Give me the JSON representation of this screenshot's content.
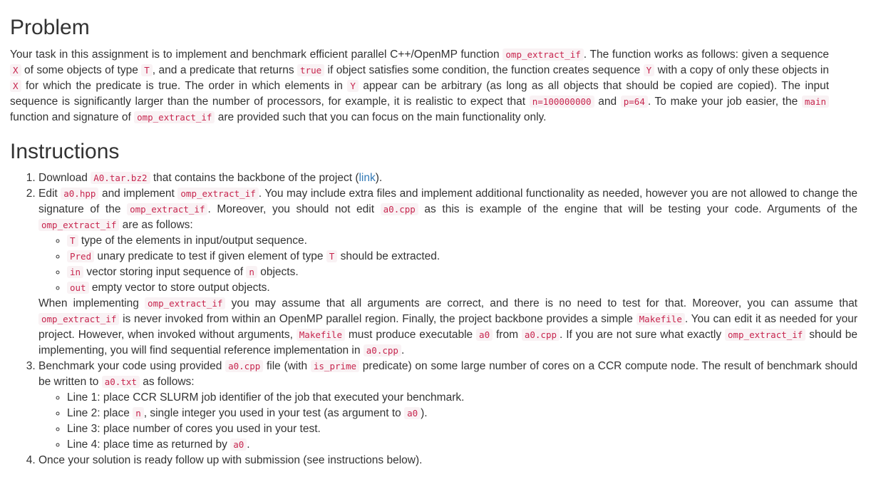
{
  "headings": {
    "problem": "Problem",
    "instructions": "Instructions"
  },
  "problem": {
    "t1": "Your task in this assignment is to implement and benchmark efficient parallel C++/OpenMP function ",
    "c1": "omp_extract_if",
    "t2": ". The function works as follows: given a sequence ",
    "c2": "X",
    "t3": " of some objects of type ",
    "c3": "T",
    "t4": ", and a predicate that returns ",
    "c4": "true",
    "t5": " if object satisfies some condition, the function creates sequence ",
    "c5": "Y",
    "t6": " with a copy of only these objects in ",
    "c6": "X",
    "t7": " for which the predicate is true. The order in which elements in ",
    "c7": "Y",
    "t8": " appear can be arbitrary (as long as all objects that should be copied are copied). The input sequence is significantly larger than the number of processors, for example, it is realistic to expect that ",
    "c8": "n=100000000",
    "t9": " and ",
    "c9": "p=64",
    "t10": ". To make your job easier, the ",
    "c10": "main",
    "t11": " function and signature of ",
    "c11": "omp_extract_if",
    "t12": " are provided such that you can focus on the main functionality only."
  },
  "steps": {
    "s1": {
      "t1": "Download ",
      "c1": "A0.tar.bz2",
      "t2": " that contains the backbone of the project (",
      "link": "link",
      "t3": ")."
    },
    "s2": {
      "t1": "Edit ",
      "c1": "a0.hpp",
      "t2": " and implement ",
      "c2": "omp_extract_if",
      "t3": ". You may include extra files and implement additional functionality as needed, however you are not allowed to change the signature of the ",
      "c3": "omp_extract_if",
      "t4": ". Moreover, you should not edit ",
      "c4": "a0.cpp",
      "t5": " as this is example of the engine that will be testing your code. Arguments of the ",
      "c5": "omp_extract_if",
      "t6": " are as follows:",
      "args": [
        {
          "code": "T",
          "text": " type of the elements in input/output sequence."
        },
        {
          "code": "Pred",
          "text": " unary predicate to test if given element of type ",
          "code2": "T",
          "text2": " should be extracted."
        },
        {
          "code": "in",
          "text": " vector storing input sequence of ",
          "code2": "n",
          "text2": " objects."
        },
        {
          "code": "out",
          "text": " empty vector to store output objects."
        }
      ],
      "w1": "When implementing ",
      "wc1": "omp_extract_if",
      "w2": " you may assume that all arguments are correct, and there is no need to test for that. Moreover, you can assume that ",
      "wc2": "omp_extract_if",
      "w3": " is never invoked from within an OpenMP parallel region. Finally, the project backbone provides a simple ",
      "wc3": "Makefile",
      "w4": ". You can edit it as needed for your project. However, when invoked without arguments, ",
      "wc4": "Makefile",
      "w5": " must produce executable ",
      "wc5": "a0",
      "w6": " from ",
      "wc6": "a0.cpp",
      "w7": ". If you are not sure what exactly ",
      "wc7": "omp_extract_if",
      "w8": " should be implementing, you will find sequential reference implementation in ",
      "wc8": "a0.cpp",
      "w9": "."
    },
    "s3": {
      "t1": "Benchmark your code using provided ",
      "c1": "a0.cpp",
      "t2": " file (with ",
      "c2": "is_prime",
      "t3": " predicate) on some large number of cores on a CCR compute node. The result of benchmark should be written to ",
      "c3": "a0.txt",
      "t4": " as follows:",
      "lines": {
        "l1": "Line 1: place CCR SLURM job identifier of the job that executed your benchmark.",
        "l2a": "Line 2: place ",
        "l2c": "n",
        "l2b": ", single integer you used in your test (as argument to ",
        "l2c2": "a0",
        "l2d": ").",
        "l3": "Line 3: place number of cores you used in your test.",
        "l4a": "Line 4: place time as returned by ",
        "l4c": "a0",
        "l4b": "."
      }
    },
    "s4": {
      "t1": "Once your solution is ready follow up with submission (see instructions below)."
    }
  },
  "colors": {
    "text": "#333333",
    "code_text": "#c7254e",
    "code_bg": "#f9f2f4",
    "link": "#337ab7"
  }
}
